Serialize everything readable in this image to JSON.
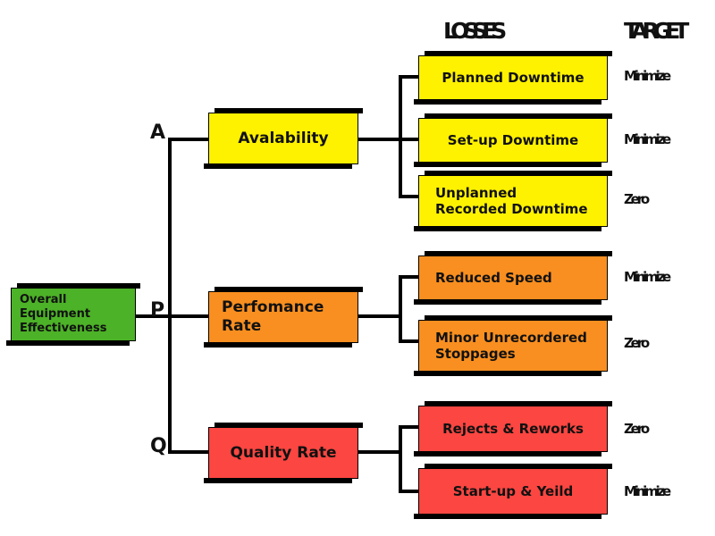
{
  "diagram": {
    "title_hidden": "OEE Loss Tree",
    "headers": {
      "losses": "LOSSES",
      "target": "TARGET"
    },
    "root": {
      "label": "Overall Equipment Effectiveness",
      "color": "#4CB227"
    },
    "branch_letters": {
      "availability": "A",
      "performance": "P",
      "quality": "Q"
    },
    "pillars": [
      {
        "label": "Avalability",
        "color": "#FFF200"
      },
      {
        "label": "Perfomance Rate",
        "color": "#F98F20"
      },
      {
        "label": "Quality Rate",
        "color": "#FB4641"
      }
    ],
    "losses": [
      {
        "label": "Planned Downtime",
        "color": "#FFF200",
        "target": "Minimize"
      },
      {
        "label": "Set-up Downtime",
        "color": "#FFF200",
        "target": "Minimize"
      },
      {
        "label": "Unplanned Recorded Downtime",
        "color": "#FFF200",
        "target": "Zero"
      },
      {
        "label": "Reduced Speed",
        "color": "#F98F20",
        "target": "Minimize"
      },
      {
        "label": "Minor Unrecordered Stoppages",
        "color": "#F98F20",
        "target": "Zero"
      },
      {
        "label": "Rejects & Reworks",
        "color": "#FB4641",
        "target": "Zero"
      },
      {
        "label": "Start-up & Yeild",
        "color": "#FB4641",
        "target": "Minimize"
      }
    ]
  }
}
